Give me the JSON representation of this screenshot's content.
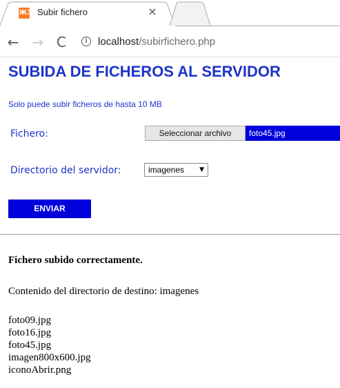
{
  "browser": {
    "tab": {
      "title": "Subir fichero",
      "favicon_glyph": "ЖЗ",
      "close_glyph": "×"
    },
    "nav": {
      "back_glyph": "←",
      "forward_glyph": "→",
      "reload_glyph": "C"
    },
    "address": {
      "info_glyph": "i",
      "host": "localhost",
      "path": "/subirfichero.php"
    }
  },
  "page": {
    "title": "SUBIDA DE FICHEROS AL SERVIDOR",
    "size_note": "Solo puede subir ficheros de hasta 10 MB",
    "form": {
      "file_label": "Fichero:",
      "file_button_label": "Seleccionar archivo",
      "file_name": "foto45.jpg",
      "dir_label": "Directorio del servidor:",
      "dir_selected": "imagenes",
      "dir_arrow": "▼",
      "send_label": "ENVIAR"
    },
    "result": {
      "message": "Fichero subido correctamente.",
      "destination_line": "Contenido del directorio de destino: imagenes",
      "files": [
        "foto09.jpg",
        "foto16.jpg",
        "foto45.jpg",
        "imagen800x600.jpg",
        "iconoAbrir.png"
      ]
    }
  },
  "colors": {
    "accent_blue": "#1d33c8",
    "button_blue": "#0000dd",
    "favicon_orange": "#fb7a24"
  }
}
